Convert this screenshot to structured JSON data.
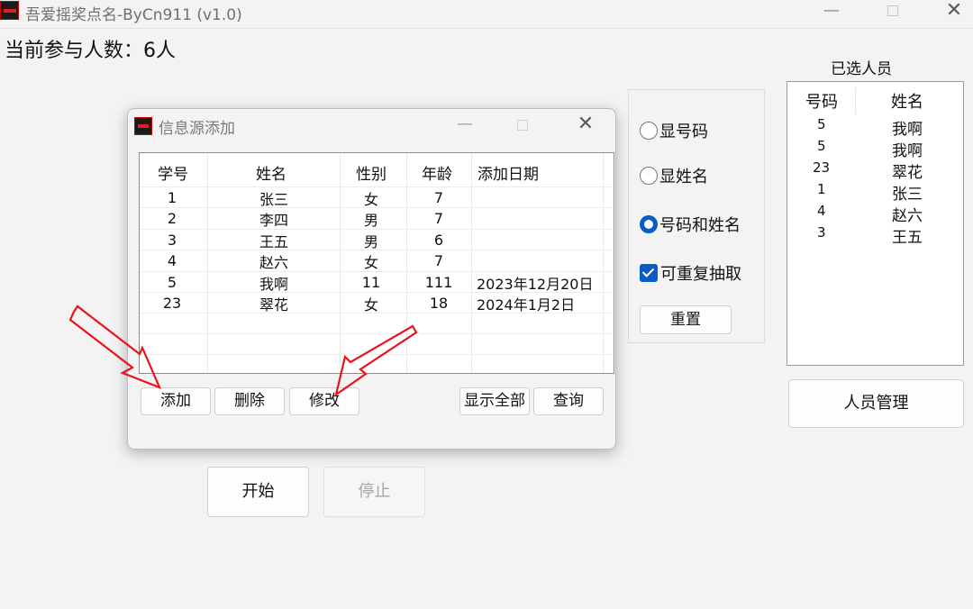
{
  "window": {
    "title": "吾爱摇奖点名-ByCn911  (v1.0)",
    "min_glyph": "—",
    "close_glyph": "✕"
  },
  "participants_text": "当前参与人数：6人",
  "options": {
    "show_number": {
      "label": "显号码",
      "checked": false
    },
    "show_name": {
      "label": "显姓名",
      "checked": false
    },
    "number_and_name": {
      "label": "号码和姓名",
      "checked": true
    },
    "repeat_draw": {
      "label": "可重复抽取",
      "checked": true
    },
    "reset_label": "重置"
  },
  "selected": {
    "label": "已选人员",
    "headers": [
      "号码",
      "姓名"
    ],
    "rows": [
      {
        "num": "5",
        "name": "我啊"
      },
      {
        "num": "5",
        "name": "我啊"
      },
      {
        "num": "23",
        "name": "翠花"
      },
      {
        "num": "1",
        "name": "张三"
      },
      {
        "num": "4",
        "name": "赵六"
      },
      {
        "num": "3",
        "name": "王五"
      }
    ]
  },
  "people_manage_label": "人员管理",
  "start_label": "开始",
  "stop_label": "停止",
  "dialog": {
    "title": "信息源添加",
    "min_glyph": "—",
    "close_glyph": "✕",
    "headers": [
      "学号",
      "姓名",
      "性别",
      "年龄",
      "添加日期"
    ],
    "rows": [
      [
        "1",
        "张三",
        "女",
        "7",
        ""
      ],
      [
        "2",
        "李四",
        "男",
        "7",
        ""
      ],
      [
        "3",
        "王五",
        "男",
        "6",
        ""
      ],
      [
        "4",
        "赵六",
        "女",
        "7",
        ""
      ],
      [
        "5",
        "我啊",
        "11",
        "111",
        "2023年12月20日"
      ],
      [
        "23",
        "翠花",
        "女",
        "18",
        "2024年1月2日"
      ]
    ],
    "buttons": {
      "add": "添加",
      "delete": "删除",
      "modify": "修改",
      "show_all": "显示全部",
      "query": "查询"
    }
  },
  "colors": {
    "accent": "#0b5cc5",
    "annotation_arrow": "#e8141b",
    "background": "#f3f3f3"
  }
}
